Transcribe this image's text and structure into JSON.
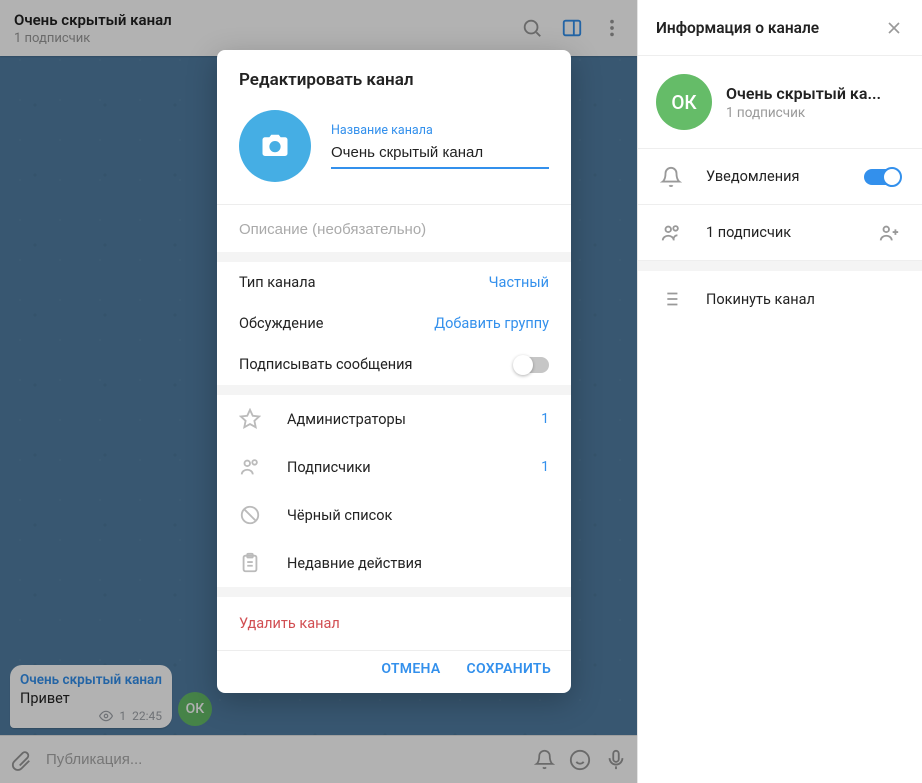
{
  "header": {
    "title": "Очень скрытый канал",
    "subtitle": "1 подписчик"
  },
  "message": {
    "sender": "Очень скрытый канал",
    "body": "Привет",
    "views": "1",
    "time": "22:45"
  },
  "avatar_initials": "ОК",
  "composer": {
    "placeholder": "Публикация..."
  },
  "panel": {
    "title": "Информация о канале",
    "name": "Очень скрытый ка...",
    "subtitle": "1 подписчик",
    "notifications": "Уведомления",
    "subscribers": "1 подписчик",
    "leave": "Покинуть канал"
  },
  "modal": {
    "title": "Редактировать канал",
    "name_label": "Название канала",
    "name_value": "Очень скрытый канал",
    "desc_placeholder": "Описание (необязательно)",
    "type_label": "Тип канала",
    "type_value": "Частный",
    "discussion_label": "Обсуждение",
    "discussion_action": "Добавить группу",
    "sign_label": "Подписывать сообщения",
    "admins": "Администраторы",
    "admins_n": "1",
    "subs": "Подписчики",
    "subs_n": "1",
    "blacklist": "Чёрный список",
    "recent": "Недавние действия",
    "delete": "Удалить канал",
    "cancel": "ОТМЕНА",
    "save": "СОХРАНИТЬ"
  }
}
